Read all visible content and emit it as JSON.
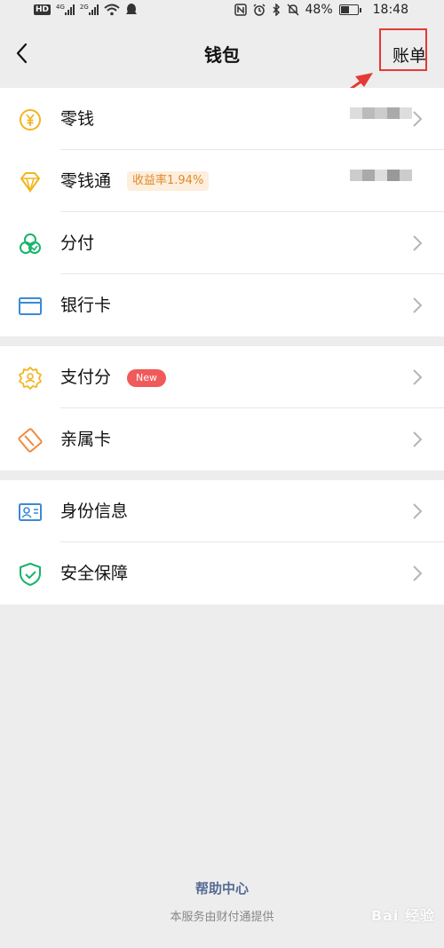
{
  "status_bar": {
    "hd": "HD",
    "net1": "4G",
    "net2": "2G",
    "battery": "48%",
    "battery_level": 0.48,
    "time": "18:48"
  },
  "header": {
    "title": "钱包",
    "bill_label": "账单"
  },
  "groups": [
    {
      "items": [
        {
          "label": "零钱",
          "icon": "yuan-coin-icon",
          "color": "#f2b51f"
        },
        {
          "label": "零钱通",
          "icon": "diamond-icon",
          "color": "#f2b51f",
          "badge": "收益率1.94%"
        },
        {
          "label": "分付",
          "icon": "fenfu-icon",
          "color": "#16b46a"
        },
        {
          "label": "银行卡",
          "icon": "bank-card-icon",
          "color": "#3b8ad4"
        }
      ]
    },
    {
      "items": [
        {
          "label": "支付分",
          "icon": "pay-score-icon",
          "color": "#f2b51f",
          "badge": "New"
        },
        {
          "label": "亲属卡",
          "icon": "family-card-icon",
          "color": "#f08a3c"
        }
      ]
    },
    {
      "items": [
        {
          "label": "身份信息",
          "icon": "id-card-icon",
          "color": "#3b8ad4"
        },
        {
          "label": "安全保障",
          "icon": "shield-icon",
          "color": "#16b46a"
        }
      ]
    }
  ],
  "footer": {
    "help_label": "帮助中心",
    "provider_text": "本服务由财付通提供",
    "watermark": "Bai 经验"
  },
  "colors": {
    "background": "#ededed",
    "link": "#576b95",
    "highlight": "#e53935"
  }
}
